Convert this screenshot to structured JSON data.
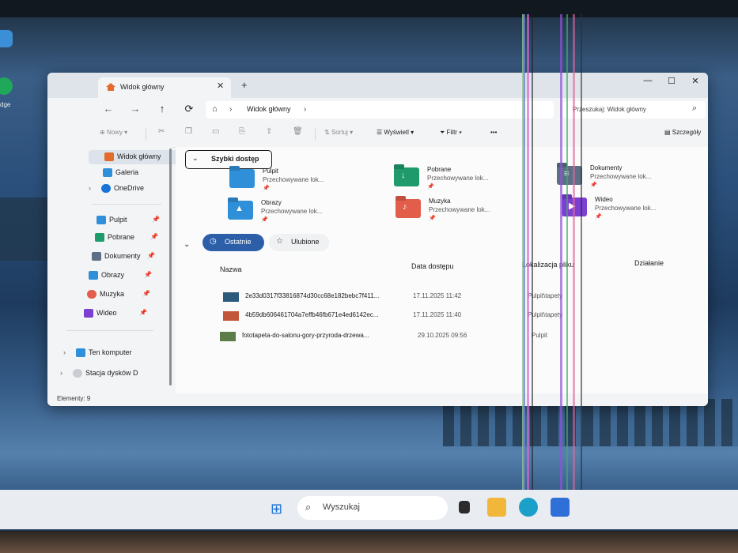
{
  "desktop": {
    "icon_label": "dge"
  },
  "window": {
    "tab_title": "Widok główny",
    "new_tab": "+",
    "close_tab": "✕",
    "minimize": "—",
    "maximize": "☐",
    "close": "✕"
  },
  "nav": {
    "back": "←",
    "forward": "→",
    "up": "↑",
    "refresh": "⟳",
    "breadcrumb": "Widok główny",
    "search_placeholder": "Przeszukaj: Widok główny"
  },
  "toolbar": {
    "new": "Nowy",
    "sort": "Sortuj",
    "view": "Wyświetl",
    "filter": "Filtr",
    "more": "•••",
    "details": "Szczegóły"
  },
  "sidebar": {
    "items": [
      {
        "label": "Widok główny",
        "icon": "home-icon",
        "color": "#e36b2c"
      },
      {
        "label": "Galeria",
        "icon": "gallery-icon",
        "color": "#2f8fd8"
      },
      {
        "label": "OneDrive",
        "icon": "cloud-icon",
        "color": "#1a73d9"
      },
      {
        "label": "Pulpit",
        "icon": "desktop-icon",
        "color": "#2f8fd8"
      },
      {
        "label": "Pobrane",
        "icon": "download-icon",
        "color": "#1f9a6a"
      },
      {
        "label": "Dokumenty",
        "icon": "documents-icon",
        "color": "#5c6f87"
      },
      {
        "label": "Obrazy",
        "icon": "pictures-icon",
        "color": "#2f8fd8"
      },
      {
        "label": "Muzyka",
        "icon": "music-icon",
        "color": "#e35d4b"
      },
      {
        "label": "Wideo",
        "icon": "video-icon",
        "color": "#7b3fd1"
      },
      {
        "label": "Ten komputer",
        "icon": "computer-icon",
        "color": "#2f8fd8"
      },
      {
        "label": "Stacja dysków D",
        "icon": "disc-icon",
        "color": "#c9ccd1"
      }
    ]
  },
  "quick_access": {
    "title": "Szybki dostęp",
    "subtitle": "Przechowywane lok...",
    "folders": [
      {
        "name": "Pulpit",
        "color": "#2f8fd8"
      },
      {
        "name": "Pobrane",
        "color": "#1f9a6a"
      },
      {
        "name": "Dokumenty",
        "color": "#5c6f87"
      },
      {
        "name": "Obrazy",
        "color": "#2f8fd8"
      },
      {
        "name": "Muzyka",
        "color": "#e35d4b"
      },
      {
        "name": "Wideo",
        "color": "#7b3fd1"
      }
    ]
  },
  "recent": {
    "tab_recent": "Ostatnie",
    "tab_favorites": "Ulubione",
    "columns": {
      "name": "Nazwa",
      "date": "Data dostępu",
      "location": "Lokalizacja pliku",
      "activity": "Działanie"
    },
    "files": [
      {
        "name": "2e33d0317f33816874d30cc68e182bebc7f411...",
        "date": "17.11.2025 11:42",
        "location": "Pulpit\\tapety",
        "thumb": "#2b5a7a"
      },
      {
        "name": "4b59db606461704a7effb46fb671e4ed6142ec...",
        "date": "17.11.2025 11:40",
        "location": "Pulpit\\tapety",
        "thumb": "#c2563a"
      },
      {
        "name": "fototapeta-do-salonu-gory-przyroda-drzewa...",
        "date": "29.10.2025 09:56",
        "location": "Pulpit",
        "thumb": "#5a7d4a"
      }
    ]
  },
  "status": {
    "items": "Elementy: 9"
  },
  "taskbar": {
    "search_placeholder": "Wyszukaj"
  }
}
